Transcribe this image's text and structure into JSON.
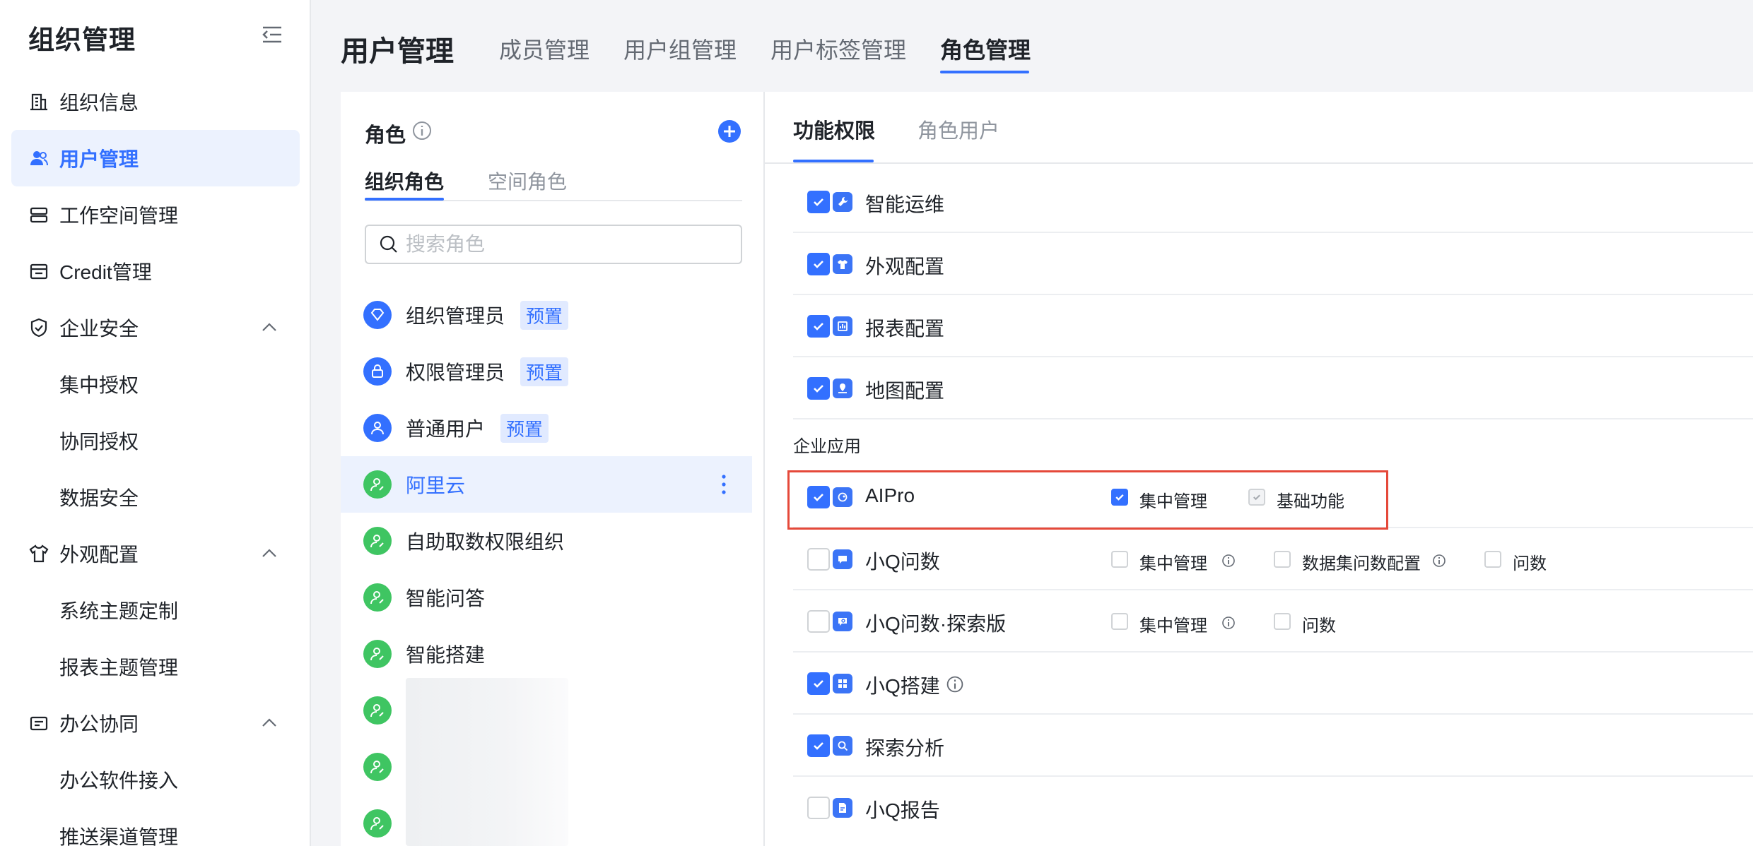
{
  "sidebar": {
    "title": "组织管理",
    "items": [
      {
        "label": "组织信息"
      },
      {
        "label": "用户管理"
      },
      {
        "label": "工作空间管理"
      },
      {
        "label": "Credit管理"
      },
      {
        "label": "企业安全"
      },
      {
        "label": "集中授权"
      },
      {
        "label": "协同授权"
      },
      {
        "label": "数据安全"
      },
      {
        "label": "外观配置"
      },
      {
        "label": "系统主题定制"
      },
      {
        "label": "报表主题管理"
      },
      {
        "label": "办公协同"
      },
      {
        "label": "办公软件接入"
      },
      {
        "label": "推送渠道管理"
      }
    ]
  },
  "header": {
    "title": "用户管理",
    "tabs": [
      {
        "label": "成员管理"
      },
      {
        "label": "用户组管理"
      },
      {
        "label": "用户标签管理"
      },
      {
        "label": "角色管理"
      }
    ]
  },
  "roles": {
    "title": "角色",
    "tabs": [
      {
        "label": "组织角色"
      },
      {
        "label": "空间角色"
      }
    ],
    "search_placeholder": "搜索角色",
    "preset_tag": "预置",
    "list": [
      {
        "name": "组织管理员"
      },
      {
        "name": "权限管理员"
      },
      {
        "name": "普通用户"
      },
      {
        "name": "阿里云"
      },
      {
        "name": "自助取数权限组织"
      },
      {
        "name": "智能问答"
      },
      {
        "name": "智能搭建"
      }
    ]
  },
  "permissions": {
    "tabs": [
      {
        "label": "功能权限"
      },
      {
        "label": "角色用户"
      }
    ],
    "top_rows": [
      {
        "name": "智能运维",
        "checked": true
      },
      {
        "name": "外观配置",
        "checked": true
      },
      {
        "name": "报表配置",
        "checked": true
      },
      {
        "name": "地图配置",
        "checked": true
      }
    ],
    "section_label": "企业应用",
    "apps": [
      {
        "name": "AIPro",
        "checked": true,
        "options": [
          "集中管理",
          "基础功能"
        ]
      },
      {
        "name": "小Q问数",
        "checked": false,
        "options": [
          "集中管理",
          "数据集问数配置",
          "问数"
        ]
      },
      {
        "name": "小Q问数·探索版",
        "checked": false,
        "options": [
          "集中管理",
          "问数"
        ]
      },
      {
        "name": "小Q搭建",
        "checked": true
      },
      {
        "name": "探索分析",
        "checked": true
      },
      {
        "name": "小Q报告",
        "checked": false
      }
    ]
  },
  "colors": {
    "accent": "#3370ff",
    "highlight": "#e5493a",
    "role_green": "#3fc562"
  }
}
